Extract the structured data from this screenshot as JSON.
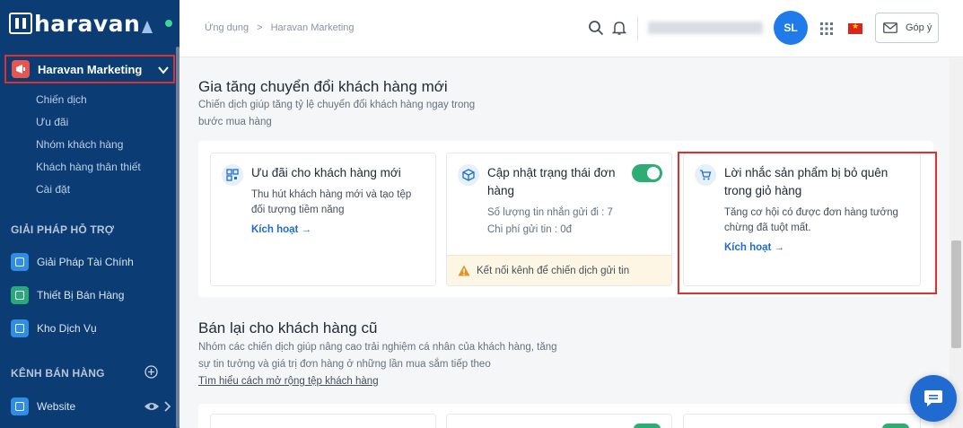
{
  "sidebar": {
    "brand": "haravan",
    "app": {
      "label": "Haravan Marketing"
    },
    "sub_items": [
      "Chiến dịch",
      "Ưu đãi",
      "Nhóm khách hàng",
      "Khách hàng thân thiết",
      "Cài đặt"
    ],
    "support_title": "GIẢI PHÁP HỖ TRỢ",
    "support_items": [
      "Giải Pháp Tài Chính",
      "Thiết Bị Bán Hàng",
      "Kho Dịch Vụ"
    ],
    "channels_title": "KÊNH BÁN HÀNG",
    "channel_items": [
      "Website"
    ]
  },
  "header": {
    "breadcrumb": [
      "Ứng dụng",
      "Haravan Marketing"
    ],
    "breadcrumb_sep": ">",
    "avatar_initials": "SL",
    "feedback_label": "Góp ý"
  },
  "section1": {
    "title": "Gia tăng chuyển đổi khách hàng mới",
    "desc_line1": "Chiến dịch giúp tăng tỷ lệ chuyển đổi khách hàng ngay trong",
    "desc_line2": "bước mua hàng",
    "cards": [
      {
        "title": "Ưu đãi cho khách hàng mới",
        "desc_line1": "Thu hút khách hàng mới và tạo tệp",
        "desc_line2": "đối tượng tiềm năng",
        "link": "Kích hoạt →"
      },
      {
        "title_line1": "Cập nhật trạng thái đơn",
        "title_line2": "hàng",
        "stat1": "Số lượng tin nhắn gửi đi : 7",
        "stat2": "Chi phí gửi tin : 0đ",
        "warning": "Kết nối kênh để chiến dịch gửi tin"
      },
      {
        "title_line1": "Lời nhắc sản phẩm bị bỏ quên",
        "title_line2": "trong giỏ hàng",
        "desc_line1": "Tăng cơ hội có được đơn hàng tưởng",
        "desc_line2": "chừng đã tuột mất.",
        "link": "Kích hoạt →"
      }
    ]
  },
  "section2": {
    "title": "Bán lại cho khách hàng cũ",
    "desc_line1": "Nhóm các chiến dịch giúp nâng cao trải nghiệm cá nhân của khách hàng, tăng",
    "desc_line2": "sự tin tưởng và giá trị đơn hàng ở những lần mua sắm tiếp theo",
    "link": "Tìm hiểu cách mở rộng tệp khách hàng"
  },
  "colors": {
    "sidebar_bg": "#0b3c73",
    "accent": "#1f6bcf",
    "toggle_on": "#2dac74",
    "highlight": "#e02f2f"
  }
}
